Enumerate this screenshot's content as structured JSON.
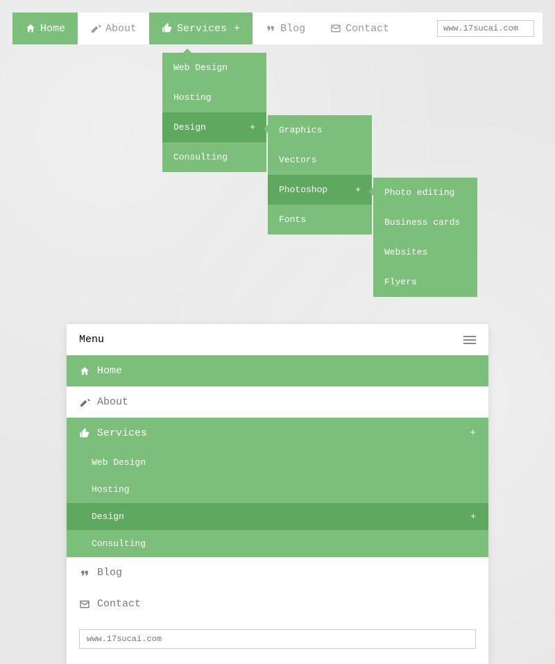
{
  "nav": {
    "home": "Home",
    "about": "About",
    "services": "Services",
    "blog": "Blog",
    "contact": "Contact",
    "plus": "+",
    "searchPlaceholder": "www.17sucai.com"
  },
  "dd1": {
    "webdesign": "Web Design",
    "hosting": "Hosting",
    "design": "Design",
    "consulting": "Consulting"
  },
  "dd2": {
    "graphics": "Graphics",
    "vectors": "Vectors",
    "photoshop": "Photoshop",
    "fonts": "Fonts"
  },
  "dd3": {
    "photoediting": "Photo editing",
    "businesscards": "Business cards",
    "websites": "Websites",
    "flyers": "Flyers"
  },
  "mobile": {
    "menu": "Menu",
    "home": "Home",
    "about": "About",
    "services": "Services",
    "webdesign": "Web Design",
    "hosting": "Hosting",
    "design": "Design",
    "consulting": "Consulting",
    "blog": "Blog",
    "contact": "Contact",
    "searchPlaceholder": "www.17sucai.com"
  }
}
